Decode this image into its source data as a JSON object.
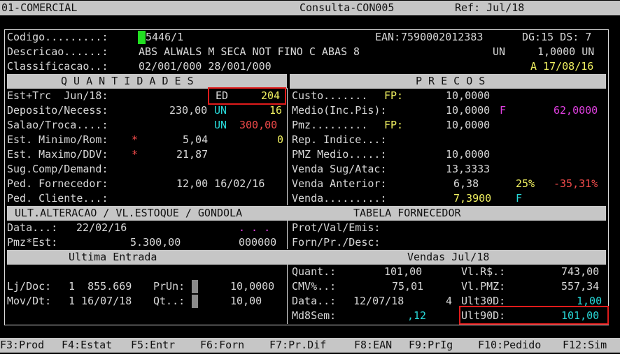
{
  "header": {
    "system": "01-COMERCIAL",
    "screen": "Consulta-CON005",
    "ref": "Ref: Jul/18"
  },
  "product": {
    "codigo_label": "Codigo.........:",
    "codigo_value": "5446/1",
    "ean_label": "EAN:",
    "ean_value": "7590002012383",
    "dg_ds": "DG:15 DS: 7",
    "descricao_label": "Descricao......:",
    "descricao_value": "ABS ALWALS M SECA NOT FINO C ABAS 8",
    "unit": "UN",
    "qty_unit": "1,0000 UN",
    "classificacao_label": "Classificacao..:",
    "classificacao_value": "02/001/000 28/001/000",
    "status": "A 17/08/16"
  },
  "quantidades": {
    "title": "Q U A N T I D A D E S",
    "est_label": "Est+Trc  Jun/18:",
    "est_tag": "ED",
    "est_value": "204",
    "deposito_label": "Deposito/Necess:",
    "deposito_value": "230,00",
    "deposito_unit": "UN",
    "deposito_necess": "16",
    "salao_label": "Salao/Troca....:",
    "salao_unit": "UN",
    "salao_value": "300,00",
    "min_label": "Est. Minimo/Rom:",
    "min_star": "*",
    "min_value": "5,04",
    "min_rom": "0",
    "max_label": "Est. Maximo/DDV:",
    "max_star": "*",
    "max_value": "21,87",
    "sug_label": "Sug.Comp/Demand:",
    "ped_forn_label": "Ped. Fornecedor:",
    "ped_forn_value": "12,00 16/02/16",
    "ped_cli_label": "Ped. Cliente...:"
  },
  "precos": {
    "title": "P R E C O S",
    "custo_label": "Custo.......",
    "custo_fp": "FP:",
    "custo_value": "10,0000",
    "medio_label": "Medio(Inc.Pis):",
    "medio_value": "10,0000",
    "medio_flag": "F",
    "medio_extra": "62,0000",
    "pmz_label": "Pmz.........",
    "pmz_fp": "FP:",
    "pmz_value": "10,0000",
    "rep_label": "Rep. Indice...:",
    "pmz_medio_label": "PMZ Medio.....:",
    "pmz_medio_value": "10,0000",
    "venda_sug_label": "Venda Sug/Atac:",
    "venda_sug_value": "13,3333",
    "venda_ant_label": "Venda Anterior:",
    "venda_ant_value": "6,38",
    "venda_ant_pct": "25%",
    "venda_ant_var": "-35,31%",
    "venda_label": "Venda.........:",
    "venda_value": "7,3900",
    "venda_flag": "F"
  },
  "ult_alteracao": {
    "title": "ULT.ALTERACAO / VL.ESTOQUE / GONDOLA",
    "data_label": "Data...:",
    "data_value": "22/02/16",
    "dots": ". . .",
    "pmz_label": "Pmz*Est:",
    "pmz_value": "5.300,00",
    "gondola": "000000"
  },
  "tabela_fornecedor": {
    "title": "TABELA FORNECEDOR",
    "prot_label": "Prot/Val/Emis:",
    "forn_label": "Forn/Pr./Desc:"
  },
  "ultima_entrada": {
    "title": "Ultima Entrada",
    "lj_label": "Lj/Doc:",
    "lj_value": "1  855.669",
    "prun_label": "PrUn:",
    "prun_value": "10,0000",
    "mov_label": "Mov/Dt:",
    "mov_value": "1 16/07/18",
    "qt_label": "Qt..:",
    "qt_value": "10,00"
  },
  "vendas": {
    "title": "Vendas Jul/18",
    "quant_label": "Quant.:",
    "quant_value": "101,00",
    "vlr_label": "Vl.R$.:",
    "vlr_value": "743,00",
    "cmv_label": "CMV%..:",
    "cmv_value": "75,01",
    "vlpmz_label": "Vl.PMZ:",
    "vlpmz_value": "557,34",
    "data_label": "Data..:",
    "data_value": "12/07/18",
    "data_extra": "4",
    "ult30_label": "Ult30D:",
    "ult30_value": "1,00",
    "md8_label": "Md8Sem:",
    "md8_value": ",12",
    "ult90_label": "Ult90D:",
    "ult90_value": "101,00"
  },
  "function_keys": {
    "f3": "F3:Prod",
    "f4": "F4:Estat",
    "f5": "F5:Entr",
    "f6": "F6:Forn",
    "f7": "F7:Pr.Dif",
    "f8": "F8:EAN",
    "f9": "F9:PrIg",
    "f10": "F10:Pedido",
    "f12": "F12:Sim"
  },
  "colors": {
    "background": "#000000",
    "bar": "#c6c6c6",
    "highlight_box": "#e01b1b",
    "cursor": "#22e022"
  }
}
